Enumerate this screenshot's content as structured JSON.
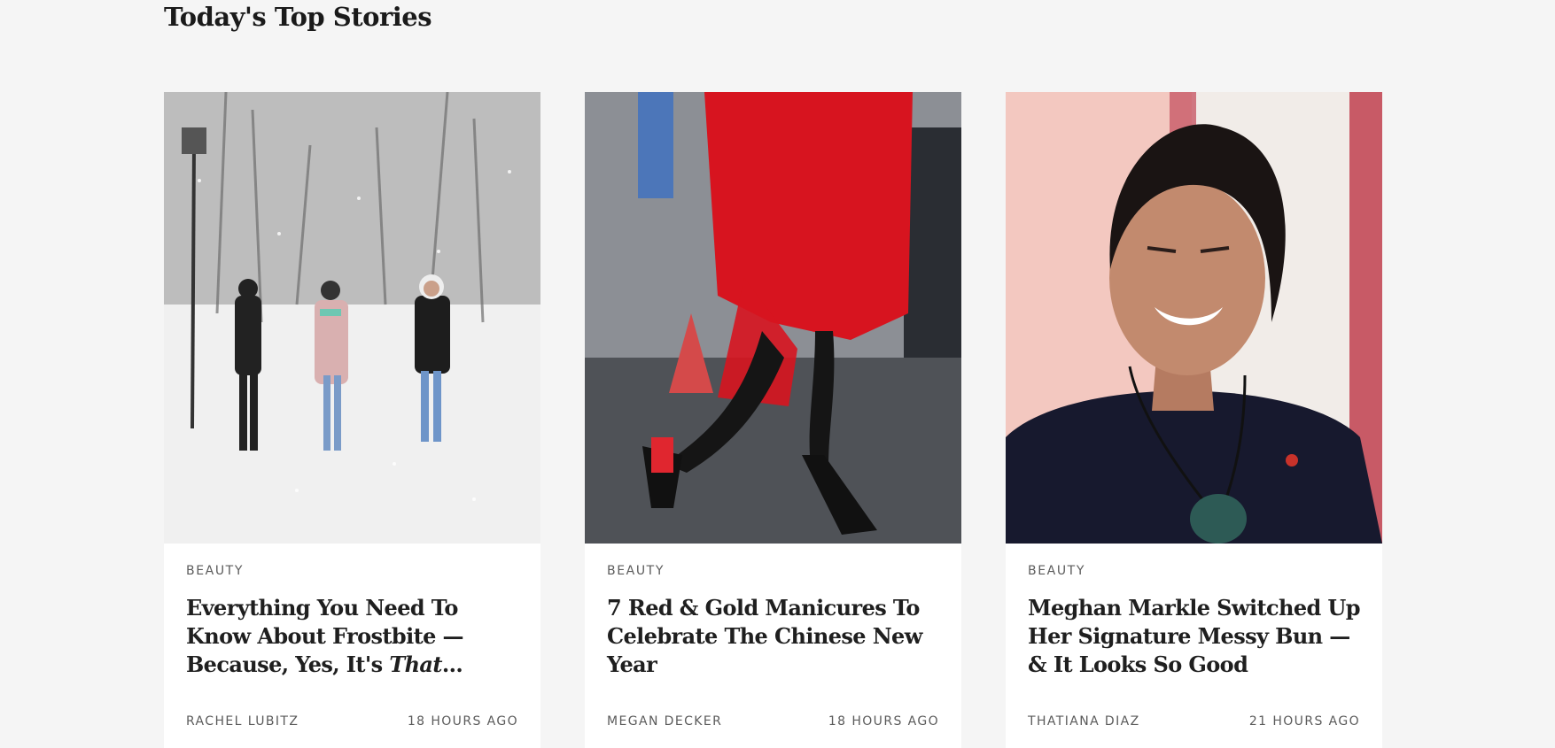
{
  "section": {
    "title": "Today's Top Stories"
  },
  "cards": [
    {
      "category": "BEAUTY",
      "headline_main": "Everything You Need To Know About Frostbite — Because, Yes, It's ",
      "headline_em": "That",
      "headline_tail": "...",
      "author": "RACHEL LUBITZ",
      "time": "18 HOURS AGO",
      "image_icon": "snowy-park-photo"
    },
    {
      "category": "BEAUTY",
      "headline_main": "7 Red & Gold Manicures To Celebrate The Chinese New Year",
      "author": "MEGAN DECKER",
      "time": "18 HOURS AGO",
      "image_icon": "red-coat-street-photo"
    },
    {
      "category": "BEAUTY",
      "headline_main": "Meghan Markle Switched Up Her Signature Messy Bun — & It Looks So Good",
      "author": "THATIANA DIAZ",
      "time": "21 HOURS AGO",
      "image_icon": "portrait-photo"
    }
  ],
  "colors": {
    "page_background": "#f5f5f5",
    "card_background": "#ffffff",
    "headline": "#1f1f1f",
    "meta_text": "#5b5b5b"
  }
}
